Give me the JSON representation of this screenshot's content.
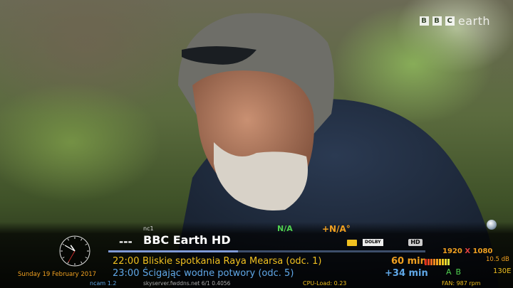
{
  "watermark": {
    "brand": "BBC",
    "text": "earth"
  },
  "clock": {
    "hour": 10,
    "minute": 50,
    "second": 35
  },
  "date": "Sunday 19 February 2017",
  "channel": {
    "number": "nc1",
    "number_prefix": "---",
    "name": "BBC Earth HD"
  },
  "indicators": {
    "na_green": "N/A",
    "na_orange": "+N/A°",
    "dolby": "DOLBY",
    "hd": "HD"
  },
  "progress": {
    "fraction": 0.41
  },
  "resolution": {
    "width": "1920",
    "x": "X",
    "height": "1080"
  },
  "epg": [
    {
      "time": "22:00",
      "title": "Bliskie spotkania Raya Mearsa (odc. 1)",
      "duration": "60 min"
    },
    {
      "time": "23:00",
      "title": "Ścigając wodne potwory (odc. 5)",
      "duration": "+34 min"
    }
  ],
  "signal": {
    "level": "10.5 dB",
    "segments": 9,
    "colors": [
      "#e03020",
      "#e84a20",
      "#ee6a20",
      "#f08a20",
      "#f0a020",
      "#f0b820",
      "#f0c820",
      "#e8d830",
      "#d8e040"
    ]
  },
  "tuner": {
    "a": "A",
    "b": "B",
    "satellite": "130E"
  },
  "footer": {
    "ncam": "ncam 1.2",
    "server": "skyserver.fwddns.net 6/1 0.4056",
    "cpu": "CPU-Load:  0.23",
    "fan": "FAN: 987 rpm"
  },
  "colors": {
    "accent_orange": "#f0a020",
    "accent_yellow": "#f0c020",
    "accent_blue": "#60a8e8",
    "accent_green": "#4fd04f"
  }
}
